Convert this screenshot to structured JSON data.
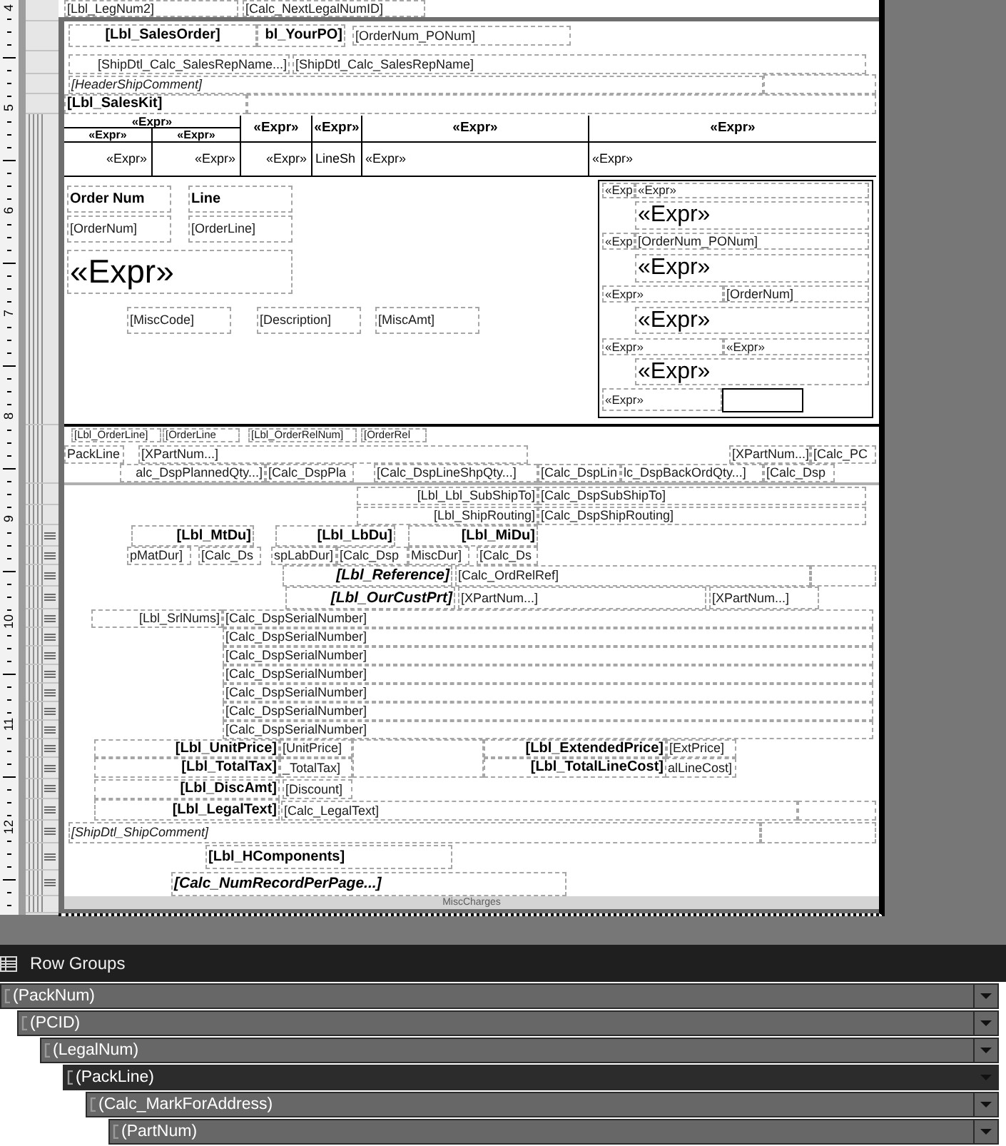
{
  "ruler": {
    "marks": [
      "4",
      "5",
      "6",
      "7",
      "8",
      "9",
      "10",
      "11",
      "12"
    ]
  },
  "report": {
    "page_header": [
      {
        "kind": "field",
        "text": "[Lbl_LegNum2]"
      },
      {
        "kind": "field",
        "text": "[Calc_NextLegalNumID]"
      }
    ],
    "header_rows": [
      {
        "kind": "label",
        "text": "[Lbl_SalesOrder]"
      },
      {
        "kind": "label",
        "text": "bl_YourPO]"
      },
      {
        "kind": "field",
        "text": "[OrderNum_PONum]"
      },
      {
        "kind": "field",
        "text": "[ShipDtl_Calc_SalesRepName...]"
      },
      {
        "kind": "field",
        "text": "[ShipDtl_Calc_SalesRepName]"
      },
      {
        "kind": "note",
        "text": "[HeaderShipComment]"
      },
      {
        "kind": "empty"
      },
      {
        "kind": "label",
        "text": "[Lbl_SalesKit]"
      },
      {
        "kind": "empty"
      }
    ],
    "table": {
      "group_header": "«Expr»",
      "subgroup_headers": [
        "«Expr»",
        "«Expr»"
      ],
      "column_headers": [
        "«Expr»",
        "«Expr»",
        "«Expr»",
        "«Expr»"
      ],
      "detail_row": [
        "«Expr»",
        "«Expr»",
        "«Expr»",
        "LineSh",
        "«Expr»",
        "«Expr»"
      ]
    },
    "order_block": [
      {
        "kind": "label",
        "text": "Order Num"
      },
      {
        "kind": "label",
        "text": "Line"
      },
      {
        "kind": "field",
        "text": "[OrderNum]"
      },
      {
        "kind": "field",
        "text": "[OrderLine]"
      },
      {
        "kind": "big",
        "text": "«Expr»"
      },
      {
        "kind": "field",
        "text": "[MiscCode]"
      },
      {
        "kind": "field",
        "text": "[Description]"
      },
      {
        "kind": "field",
        "text": "[MiscAmt]"
      },
      {
        "kind": "rectangle",
        "items": [
          {
            "kind": "small",
            "text": "«Exp"
          },
          {
            "kind": "small",
            "text": "«Expr»"
          },
          {
            "kind": "medium",
            "text": "«Expr»"
          },
          {
            "kind": "small",
            "text": "«Exp"
          },
          {
            "kind": "field",
            "text": "[OrderNum_PONum]"
          },
          {
            "kind": "medium",
            "text": "«Expr»"
          },
          {
            "kind": "small",
            "text": "«Expr»"
          },
          {
            "kind": "field",
            "text": "[OrderNum]"
          },
          {
            "kind": "medium",
            "text": "«Expr»"
          },
          {
            "kind": "small",
            "text": "«Expr»"
          },
          {
            "kind": "small",
            "text": "«Expr»"
          },
          {
            "kind": "medium",
            "text": "«Expr»"
          },
          {
            "kind": "small",
            "text": "«Expr»"
          },
          {
            "kind": "box"
          }
        ]
      }
    ],
    "group_rows": [
      {
        "kind": "tiny",
        "text": "[Lbl_OrderLine]"
      },
      {
        "kind": "tiny",
        "text": "[OrderLine"
      },
      {
        "kind": "tiny",
        "text": "[Lbl_OrderRelNum]"
      },
      {
        "kind": "tiny",
        "text": "[OrderRel"
      },
      {
        "kind": "field",
        "text": "PackLine"
      },
      {
        "kind": "field",
        "text": "[XPartNum...]"
      },
      {
        "kind": "field",
        "text": "[XPartNum...]"
      },
      {
        "kind": "field",
        "text": "[Calc_PC"
      },
      {
        "kind": "field",
        "text": "alc_DspPlannedQty...]"
      },
      {
        "kind": "field",
        "text": "[Calc_DspPla"
      },
      {
        "kind": "field",
        "text": "[Calc_DspLineShpQty...]"
      },
      {
        "kind": "field",
        "text": "[Calc_DspLin"
      },
      {
        "kind": "field",
        "text": "lc_DspBackOrdQty...]"
      },
      {
        "kind": "field",
        "text": "[Calc_Dsp"
      }
    ],
    "detail_rows": [
      {
        "kind": "field",
        "text": "[Lbl_Lbl_SubShipTo]"
      },
      {
        "kind": "field",
        "text": "[Calc_DspSubShipTo]"
      },
      {
        "kind": "field",
        "text": "[Lbl_ShipRouting]"
      },
      {
        "kind": "field",
        "text": "[Calc_DspShipRouting]"
      },
      {
        "kind": "label",
        "text": "[Lbl_MtDu]"
      },
      {
        "kind": "label",
        "text": "[Lbl_LbDu]"
      },
      {
        "kind": "label",
        "text": "[Lbl_MiDu]"
      },
      {
        "kind": "field",
        "text": "pMatDur]"
      },
      {
        "kind": "field",
        "text": "[Calc_Ds"
      },
      {
        "kind": "field",
        "text": "spLabDur]"
      },
      {
        "kind": "field",
        "text": "[Calc_Dsp"
      },
      {
        "kind": "field",
        "text": "MiscDur]"
      },
      {
        "kind": "field",
        "text": "[Calc_Ds"
      },
      {
        "kind": "caption",
        "text": "[Lbl_Reference]"
      },
      {
        "kind": "field",
        "text": "[Calc_OrdRelRef]"
      },
      {
        "kind": "empty"
      },
      {
        "kind": "caption",
        "text": "[Lbl_OurCustPrt]"
      },
      {
        "kind": "field",
        "text": "[XPartNum...]"
      },
      {
        "kind": "field",
        "text": "[XPartNum...]"
      },
      {
        "kind": "field",
        "text": "[Lbl_SrlNums]"
      },
      {
        "kind": "field",
        "text": "[Calc_DspSerialNumber]"
      },
      {
        "kind": "field",
        "text": "[Calc_DspSerialNumber]"
      },
      {
        "kind": "field",
        "text": "[Calc_DspSerialNumber]"
      },
      {
        "kind": "field",
        "text": "[Calc_DspSerialNumber]"
      },
      {
        "kind": "field",
        "text": "[Calc_DspSerialNumber]"
      },
      {
        "kind": "field",
        "text": "[Calc_DspSerialNumber]"
      },
      {
        "kind": "field",
        "text": "[Calc_DspSerialNumber]"
      },
      {
        "kind": "label",
        "text": "[Lbl_UnitPrice]"
      },
      {
        "kind": "field",
        "text": "[UnitPrice]"
      },
      {
        "kind": "empty"
      },
      {
        "kind": "label",
        "text": "[Lbl_ExtendedPrice]"
      },
      {
        "kind": "field",
        "text": "[ExtPrice]"
      },
      {
        "kind": "label",
        "text": "[Lbl_TotalTax]"
      },
      {
        "kind": "field",
        "text": "_TotalTax]"
      },
      {
        "kind": "label",
        "text": "[Lbl_TotalLineCost]"
      },
      {
        "kind": "field",
        "text": "alLineCost]"
      },
      {
        "kind": "label",
        "text": "[Lbl_DiscAmt]"
      },
      {
        "kind": "field",
        "text": "[Discount]"
      },
      {
        "kind": "label",
        "text": "[Lbl_LegalText]"
      },
      {
        "kind": "field",
        "text": "[Calc_LegalText]"
      },
      {
        "kind": "empty"
      },
      {
        "kind": "note",
        "text": "[ShipDtl_ShipComment]"
      },
      {
        "kind": "empty"
      },
      {
        "kind": "label",
        "text": "[Lbl_HComponents]"
      },
      {
        "kind": "caption",
        "text": "[Calc_NumRecordPerPage...]"
      }
    ],
    "footer": "MiscCharges"
  },
  "row_groups": {
    "title": "Row Groups",
    "groups": [
      {
        "name": "(PackNum)",
        "selected": false,
        "children": [
          {
            "name": "(PCID)",
            "selected": false,
            "children": [
              {
                "name": "(LegalNum)",
                "selected": false,
                "children": [
                  {
                    "name": "(PackLine)",
                    "selected": true,
                    "children": [
                      {
                        "name": "(Calc_MarkForAddress)",
                        "selected": false,
                        "children": [
                          {
                            "name": "(PartNum)",
                            "selected": false
                          }
                        ]
                      }
                    ]
                  }
                ]
              }
            ]
          }
        ]
      }
    ]
  }
}
